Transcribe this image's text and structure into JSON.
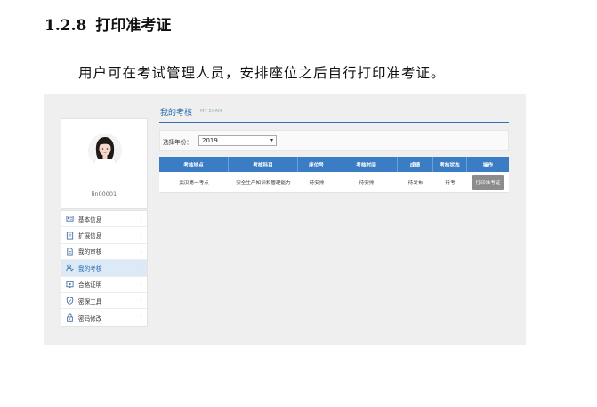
{
  "doc": {
    "section_number": "1.2.8",
    "section_title": "打印准考证",
    "paragraph": "用户可在考试管理人员，安排座位之后自行打印准考证。"
  },
  "profile": {
    "user_id": "lin00001"
  },
  "sidebar": {
    "items": [
      {
        "label": "基本信息",
        "icon": "id-card-icon"
      },
      {
        "label": "扩展信息",
        "icon": "form-icon"
      },
      {
        "label": "我的审核",
        "icon": "document-icon"
      },
      {
        "label": "我的考核",
        "icon": "user-check-icon"
      },
      {
        "label": "合格证明",
        "icon": "certificate-icon"
      },
      {
        "label": "密保工具",
        "icon": "shield-icon"
      },
      {
        "label": "密码修改",
        "icon": "lock-icon"
      }
    ],
    "active_index": 3
  },
  "main": {
    "title": "我的考核",
    "subtitle": "MY EXAM",
    "filter": {
      "label": "选择年份：",
      "selected_year": "2019"
    },
    "table": {
      "headers": [
        "考核地点",
        "考核科目",
        "座位号",
        "考核时间",
        "成绩",
        "考核状态",
        "操作"
      ],
      "rows": [
        {
          "location": "武汉第一考点",
          "subject": "安全生产知识和管理能力",
          "seat": "待安排",
          "time": "待安排",
          "score": "待发布",
          "status": "待考",
          "action": "打印准考证"
        }
      ]
    }
  },
  "colors": {
    "accent": "#2c6db0",
    "table_header": "#3a7dc4",
    "button_gray": "#8c8c8c"
  }
}
